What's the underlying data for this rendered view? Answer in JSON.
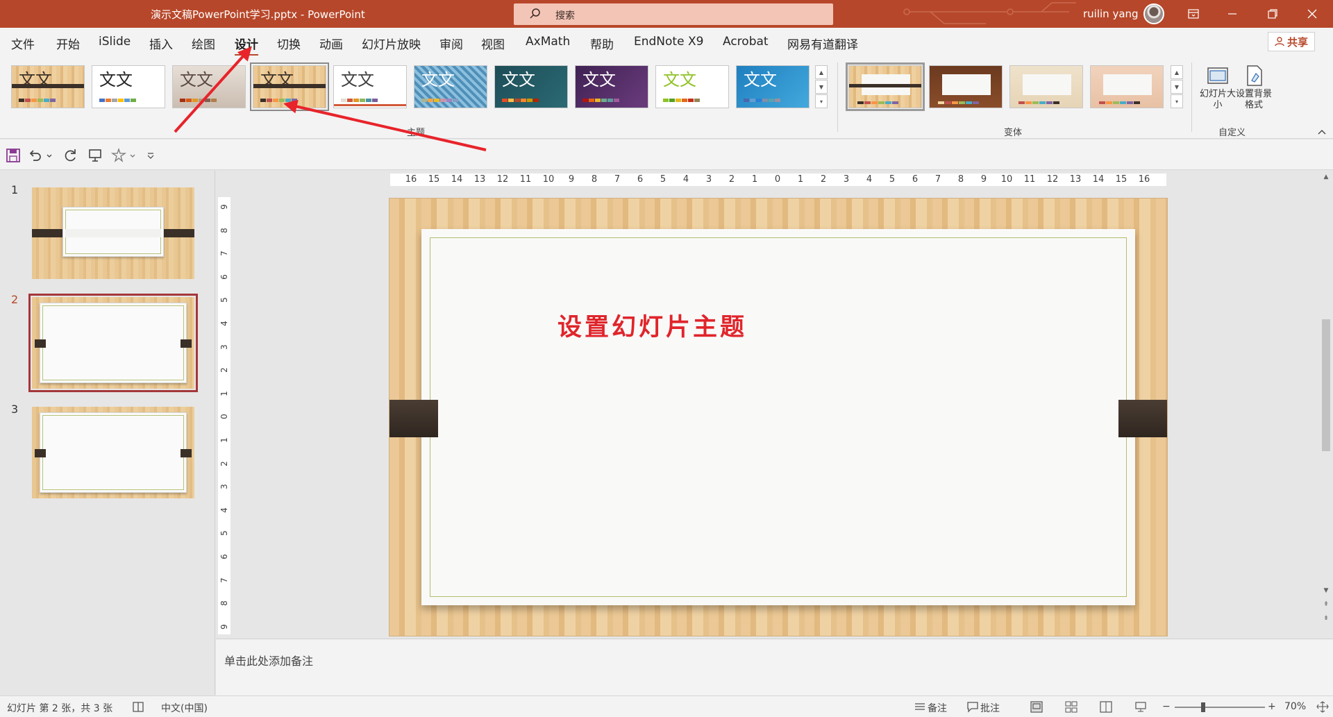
{
  "titlebar": {
    "doc_title": "演示文稿PowerPoint学习.pptx  -  PowerPoint",
    "search_placeholder": "搜索",
    "user_name": "ruilin yang"
  },
  "menu": {
    "tabs": [
      {
        "label": "文件"
      },
      {
        "label": "开始"
      },
      {
        "label": "iSlide"
      },
      {
        "label": "插入"
      },
      {
        "label": "绘图"
      },
      {
        "label": "设计",
        "active": true
      },
      {
        "label": "切换"
      },
      {
        "label": "动画"
      },
      {
        "label": "幻灯片放映"
      },
      {
        "label": "审阅"
      },
      {
        "label": "视图"
      },
      {
        "label": "AxMath"
      },
      {
        "label": "帮助"
      },
      {
        "label": "EndNote X9"
      },
      {
        "label": "Acrobat"
      },
      {
        "label": "网易有道翻译"
      }
    ],
    "share_label": "共享"
  },
  "ribbon": {
    "themes_group_label": "主题",
    "variants_group_label": "变体",
    "customize_group_label": "自定义",
    "theme_sample_text": "文文",
    "slide_size_label": "幻灯片大小",
    "format_background_label": "设置背景格式",
    "themes": [
      {
        "name": "wood-type-theme",
        "bg": "#e9c995"
      },
      {
        "name": "office-theme",
        "bg": "#ffffff"
      },
      {
        "name": "retrospect-theme",
        "bg": "#dcd3cb"
      },
      {
        "name": "wood-type-variant-theme",
        "bg": "#e5c088",
        "selected": true
      },
      {
        "name": "savon-theme",
        "bg": "#ffffff"
      },
      {
        "name": "pattern-theme",
        "bg": "#6aa6c8"
      },
      {
        "name": "ion-boardroom-theme",
        "bg": "#1e4f57"
      },
      {
        "name": "ion-theme",
        "bg": "#4b2a5a"
      },
      {
        "name": "facet-theme",
        "bg": "#ffffff"
      },
      {
        "name": "wisp-theme",
        "bg": "#2d93c9"
      }
    ],
    "variants": [
      {
        "name": "variant-wood-light",
        "selected": true
      },
      {
        "name": "variant-wood-dark"
      },
      {
        "name": "variant-wood-cream"
      },
      {
        "name": "variant-wood-peach"
      }
    ]
  },
  "thumbnails": {
    "slides": [
      {
        "number": "1"
      },
      {
        "number": "2",
        "active": true
      },
      {
        "number": "3"
      }
    ]
  },
  "editor": {
    "hruler_ticks": [
      "16",
      "15",
      "14",
      "13",
      "12",
      "11",
      "10",
      "9",
      "8",
      "7",
      "6",
      "5",
      "4",
      "3",
      "2",
      "1",
      "0",
      "1",
      "2",
      "3",
      "4",
      "5",
      "6",
      "7",
      "8",
      "9",
      "10",
      "11",
      "12",
      "13",
      "14",
      "15",
      "16"
    ],
    "vruler_ticks": [
      "9",
      "8",
      "7",
      "6",
      "5",
      "4",
      "3",
      "2",
      "1",
      "0",
      "1",
      "2",
      "3",
      "4",
      "5",
      "6",
      "7",
      "8",
      "9"
    ],
    "slide_title": "设置幻灯片主题",
    "notes_placeholder": "单击此处添加备注"
  },
  "statusbar": {
    "slide_info": "幻灯片 第 2 张，共 3 张",
    "language": "中文(中国)",
    "notes_label": "备注",
    "comments_label": "批注",
    "zoom_level": "70%"
  },
  "colors": {
    "accent": "#b7472a",
    "title_red": "#e0252b",
    "annotation_arrow": "#e8232a"
  }
}
